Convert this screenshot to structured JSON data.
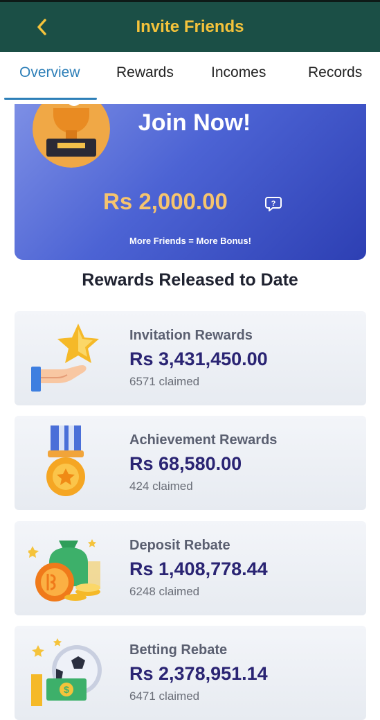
{
  "header": {
    "title": "Invite Friends"
  },
  "tabs": [
    "Overview",
    "Rewards",
    "Incomes",
    "Records"
  ],
  "hero": {
    "headline": "Join Now!",
    "amount": "Rs 2,000.00",
    "tagline": "More Friends = More Bonus!"
  },
  "section_title": "Rewards Released to Date",
  "rewards": [
    {
      "name": "Invitation Rewards",
      "value": "Rs 3,431,450.00",
      "claimed": "6571 claimed",
      "icon": "star-hand-icon"
    },
    {
      "name": "Achievement Rewards",
      "value": "Rs 68,580.00",
      "claimed": "424 claimed",
      "icon": "medal-icon"
    },
    {
      "name": "Deposit Rebate",
      "value": "Rs 1,408,778.44",
      "claimed": "6248 claimed",
      "icon": "money-bag-icon"
    },
    {
      "name": "Betting Rebate",
      "value": "Rs 2,378,951.14",
      "claimed": "6471 claimed",
      "icon": "football-cash-icon"
    }
  ],
  "colors": {
    "header_bg": "#1b4f46",
    "title": "#f5c33b",
    "tab_active": "#2d7fb8",
    "amount": "#f6c46e",
    "value": "#2a2473"
  }
}
